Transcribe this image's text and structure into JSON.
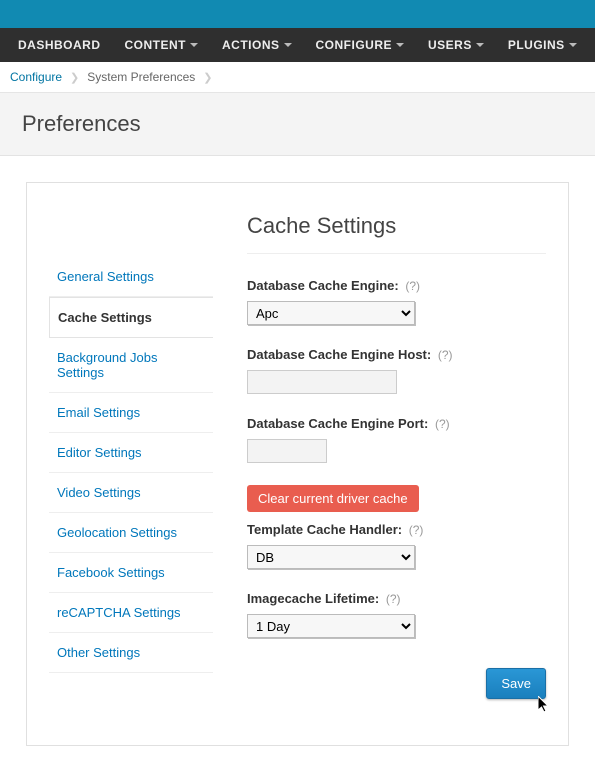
{
  "nav": {
    "dashboard": "DASHBOARD",
    "content": "CONTENT",
    "actions": "ACTIONS",
    "configure": "CONFIGURE",
    "users": "USERS",
    "plugins": "PLUGINS"
  },
  "breadcrumb": {
    "configure": "Configure",
    "current": "System Preferences"
  },
  "page_title": "Preferences",
  "tabs": {
    "general": "General Settings",
    "cache": "Cache Settings",
    "background": "Background Jobs Settings",
    "email": "Email Settings",
    "editor": "Editor Settings",
    "video": "Video Settings",
    "geolocation": "Geolocation Settings",
    "facebook": "Facebook Settings",
    "recaptcha": "reCAPTCHA Settings",
    "other": "Other Settings"
  },
  "section_heading": "Cache Settings",
  "help_marker": "(?)",
  "fields": {
    "db_cache_engine": {
      "label": "Database Cache Engine:",
      "value": "Apc"
    },
    "db_cache_host": {
      "label": "Database Cache Engine Host:",
      "value": ""
    },
    "db_cache_port": {
      "label": "Database Cache Engine Port:",
      "value": ""
    },
    "clear_cache_btn": "Clear current driver cache",
    "template_handler": {
      "label": "Template Cache Handler:",
      "value": "DB"
    },
    "imagecache_lifetime": {
      "label": "Imagecache Lifetime:",
      "value": "1 Day"
    }
  },
  "save_label": "Save"
}
